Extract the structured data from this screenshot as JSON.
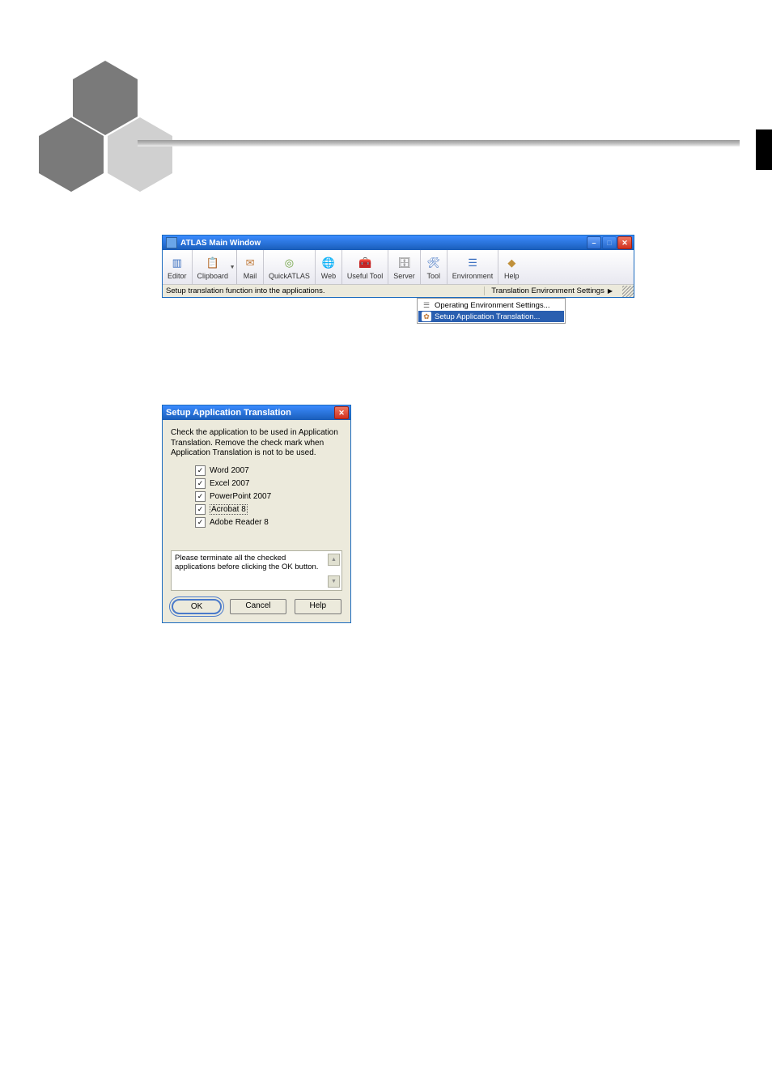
{
  "atlas": {
    "title": "ATLAS Main Window",
    "toolbar": [
      {
        "label": "Editor"
      },
      {
        "label": "Clipboard"
      },
      {
        "label": "Mail"
      },
      {
        "label": "QuickATLAS"
      },
      {
        "label": "Web"
      },
      {
        "label": "Useful Tool"
      },
      {
        "label": "Server"
      },
      {
        "label": "Tool"
      },
      {
        "label": "Environment"
      },
      {
        "label": "Help"
      }
    ],
    "status_left": "Setup translation function into the applications.",
    "status_menu": "Translation Environment Settings",
    "submenu_item_1": "Operating Environment Settings...",
    "submenu_item_2": "Setup Application Translation..."
  },
  "setup": {
    "title": "Setup Application Translation",
    "desc": "Check the application to be used in Application Translation. Remove the check mark when Application Translation is not to be used.",
    "apps": {
      "word": "Word 2007",
      "excel": "Excel 2007",
      "ppt": "PowerPoint 2007",
      "acrobat": "Acrobat 8",
      "reader": "Adobe Reader 8"
    },
    "warn": "Please terminate all the checked applications before clicking the OK button.",
    "ok": "OK",
    "cancel": "Cancel",
    "help": "Help"
  }
}
